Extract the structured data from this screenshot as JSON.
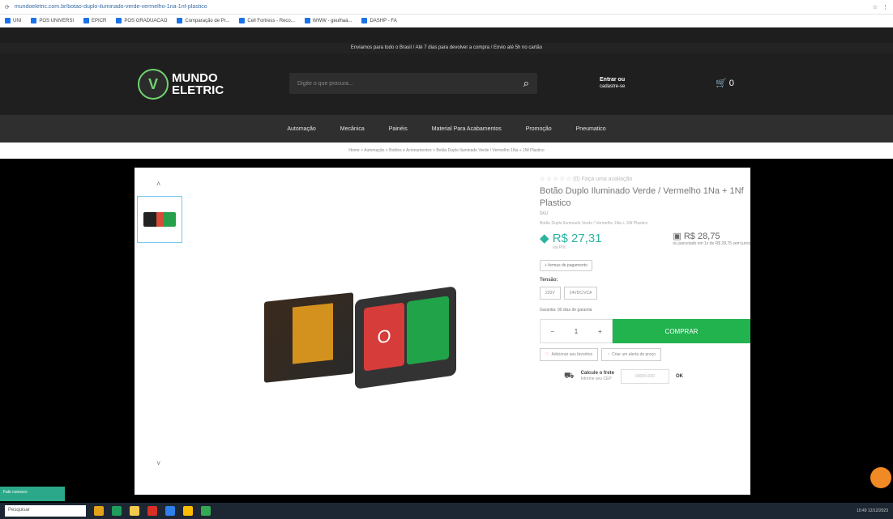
{
  "browser": {
    "url": "mundoeletric.com.br/botao-duplo-iluminado-verde-vermelho-1na-1nf-plastico",
    "bookmarks": [
      "UNI",
      "POS UNIVERSI",
      "EPICR",
      "POS GRADUACAO",
      "Comparação de Pr...",
      "Cell Fortress - Reco...",
      "WWW - geulhaá...",
      "DASHP - FA"
    ]
  },
  "header": {
    "promo": "Enviamos para todo o Brasil / Até 7 dias para devolver a compra / Envio até 5h no cartão",
    "logo_line1": "MUNDO",
    "logo_line2": "ELETRIC",
    "logo_mark": "V",
    "search_placeholder": "Digite o que procura...",
    "login_line1": "Entrar ou",
    "login_line2": "cadastre-se",
    "cart_count": "0"
  },
  "nav": {
    "items": [
      "Automação",
      "Mecânica",
      "Painéis",
      "Material Para Acabamentos",
      "Promoção",
      "Pneumatico"
    ]
  },
  "breadcrumb": "Home > Automação > Botões e Acionamentos > Botão Duplo Iluminado Verde / Vermelho 1Na + 1Nf Plastico",
  "product": {
    "rating_count": "(0) Faça uma avaliação",
    "title": "Botão Duplo Iluminado Verde / Vermelho 1Na + 1Nf Plastico",
    "sku": "SKU",
    "description": "Botão Duplo Iluminado Verde / Vermelho 1Na + 1Nf Plastico",
    "price_pix": "R$ 27,31",
    "price_pix_note": "via PIX",
    "price_card": "R$ 28,75",
    "price_card_note": "ou parcelado em 1x de R$ 28,75 sem juros",
    "payment_forms": "+ formas de pagamento",
    "voltage_label": "Tensão:",
    "voltage_options": [
      "220V",
      "24VDC/VCA"
    ],
    "warranty": "Garantia: 90 dias de garantia",
    "quantity": "1",
    "buy_label": "COMPRAR",
    "add_favorites": "Adicionar aos favoritos",
    "price_alert": "Criar um alerta de preço",
    "shipping_title": "Calcule o frete",
    "shipping_sub": "Informe seu CEP",
    "cep_placeholder": "00000-000",
    "ok_label": "OK",
    "button_face_label": "O"
  },
  "contact_tab": "Fale conosco",
  "taskbar": {
    "search_placeholder": "Pesquisar",
    "tray": "10:49 12/12/2023"
  }
}
